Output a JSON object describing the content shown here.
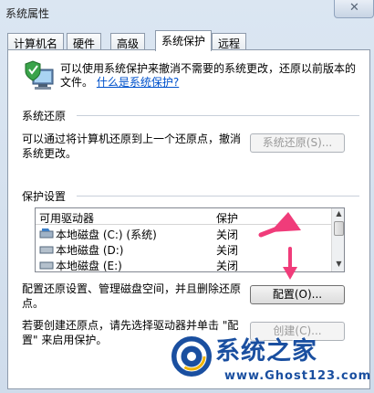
{
  "window": {
    "title": "系统属性",
    "close_glyph": "✕"
  },
  "tabs": [
    "计算机名",
    "硬件",
    "高级",
    "系统保护",
    "远程"
  ],
  "intro": {
    "text": "可以使用系统保护来撤消不需要的系统更改，还原以前版本的文件。",
    "link": "什么是系统保护?"
  },
  "restore": {
    "group_label": "系统还原",
    "description": "可以通过将计算机还原到上一个还原点，撤消系统更改。",
    "button": "系统还原(S)..."
  },
  "protection": {
    "group_label": "保护设置",
    "columns": [
      "可用驱动器",
      "保护"
    ],
    "rows": [
      {
        "name": "本地磁盘 (C:) (系统)",
        "protection": "关闭"
      },
      {
        "name": "本地磁盘 (D:)",
        "protection": "关闭"
      },
      {
        "name": "本地磁盘 (E:)",
        "protection": "关闭"
      }
    ],
    "config_description": "配置还原设置、管理磁盘空间，并且删除还原点。",
    "config_button": "配置(O)...",
    "create_description": "若要创建还原点，请先选择驱动器并单击 \"配置\" 来启用保护。",
    "create_button": "创建(C)..."
  },
  "watermark": {
    "title": "系统之家",
    "url": "www.Ghost123.com"
  },
  "colors": {
    "accent": "#1a4fa0",
    "link": "#0052cc",
    "arrow": "#f03c7a"
  }
}
